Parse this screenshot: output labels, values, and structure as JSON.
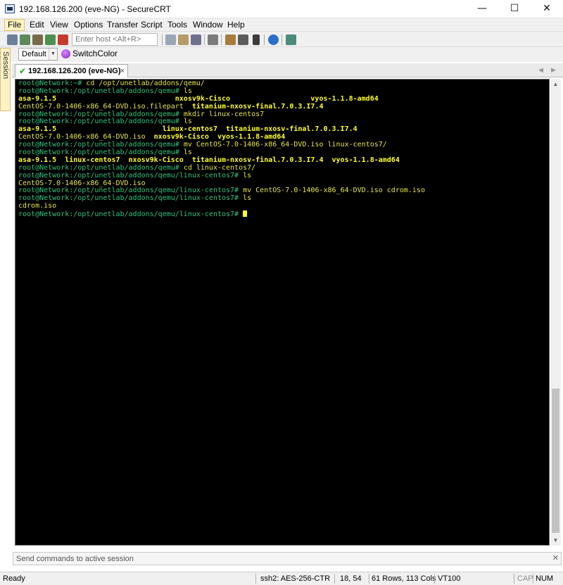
{
  "window": {
    "title": "192.168.126.200 (eve-NG) - SecureCRT"
  },
  "menu": [
    "File",
    "Edit",
    "View",
    "Options",
    "Transfer",
    "Script",
    "Tools",
    "Window",
    "Help"
  ],
  "toolbar": {
    "host_placeholder": "Enter host <Alt+R>"
  },
  "buttonbar": {
    "default_label": "Default",
    "switchcolor_label": "SwitchColor"
  },
  "sidebar": {
    "session_manager_label": "Session Manager"
  },
  "tab": {
    "label": "192.168.126.200 (eve-NG)",
    "close": "×"
  },
  "terminal": {
    "lines": [
      [
        {
          "t": "root@Network:~# ",
          "c": "prompt"
        },
        {
          "t": "cd /opt/unetlab/addons/qemu/",
          "c": "txt"
        }
      ],
      [
        {
          "t": "root@Network:/opt/unetlab/addons/qemu# ",
          "c": "prompt"
        },
        {
          "t": "ls",
          "c": "txt"
        }
      ],
      [
        {
          "t": "asa-9.1.5                            nxosv9k-Cisco                   vyos-1.1.8-amd64",
          "c": "ybold"
        }
      ],
      [
        {
          "t": "CentOS-7.0-1406-x86_64-DVD.iso.filepart  ",
          "c": "txt"
        },
        {
          "t": "titanium-nxosv-final.7.0.3.I7.4",
          "c": "ybold"
        }
      ],
      [
        {
          "t": "root@Network:/opt/unetlab/addons/qemu# ",
          "c": "prompt"
        },
        {
          "t": "mkdir linux-centos7",
          "c": "txt"
        }
      ],
      [
        {
          "t": "root@Network:/opt/unetlab/addons/qemu# ",
          "c": "prompt"
        },
        {
          "t": "ls",
          "c": "txt"
        }
      ],
      [
        {
          "t": "asa-9.1.5                         linux-centos7  titanium-nxosv-final.7.0.3.I7.4",
          "c": "ybold"
        }
      ],
      [
        {
          "t": "CentOS-7.0-1406-x86_64-DVD.iso  ",
          "c": "txt"
        },
        {
          "t": "nxosv9k-Cisco  vyos-1.1.8-amd64",
          "c": "ybold"
        }
      ],
      [
        {
          "t": "root@Network:/opt/unetlab/addons/qemu# ",
          "c": "prompt"
        },
        {
          "t": "mv CentOS-7.0-1406-x86_64-DVD.iso linux-centos7/",
          "c": "txt"
        }
      ],
      [
        {
          "t": "root@Network:/opt/unetlab/addons/qemu# ",
          "c": "prompt"
        },
        {
          "t": "ls",
          "c": "txt"
        }
      ],
      [
        {
          "t": "asa-9.1.5  linux-centos7  nxosv9k-Cisco  titanium-nxosv-final.7.0.3.I7.4  vyos-1.1.8-amd64",
          "c": "ybold"
        }
      ],
      [
        {
          "t": "root@Network:/opt/unetlab/addons/qemu# ",
          "c": "prompt"
        },
        {
          "t": "cd linux-centos7/",
          "c": "txt"
        }
      ],
      [
        {
          "t": "root@Network:/opt/unetlab/addons/qemu/linux-centos7# ",
          "c": "prompt"
        },
        {
          "t": "ls",
          "c": "txt"
        }
      ],
      [
        {
          "t": "CentOS-7.0-1406-x86_64-DVD.iso",
          "c": "txt"
        }
      ],
      [
        {
          "t": "root@Network:/opt/unetlab/addons/qemu/linux-centos7# ",
          "c": "prompt"
        },
        {
          "t": "mv CentOS-7.0-1406-x86_64-DVD.iso cdrom.iso",
          "c": "txt"
        }
      ],
      [
        {
          "t": "root@Network:/opt/unetlab/addons/qemu/linux-centos7# ",
          "c": "prompt"
        },
        {
          "t": "ls",
          "c": "txt"
        }
      ],
      [
        {
          "t": "cdrom.iso",
          "c": "txt"
        }
      ],
      [
        {
          "t": "root@Network:/opt/unetlab/addons/qemu/linux-centos7# ",
          "c": "prompt"
        }
      ]
    ]
  },
  "commandbar": {
    "placeholder": "Send commands to active session"
  },
  "status": {
    "ready": "Ready",
    "cipher": "ssh2: AES-256-CTR",
    "cursor": "18,  54",
    "size": "61 Rows, 113 Cols",
    "emulation": "VT100",
    "cap": "CAP",
    "num": "NUM"
  },
  "colors": {
    "prompt": "#2ec27e",
    "output": "#e5e548",
    "highlight": "#ffff2a",
    "terminal_bg": "#000000"
  }
}
